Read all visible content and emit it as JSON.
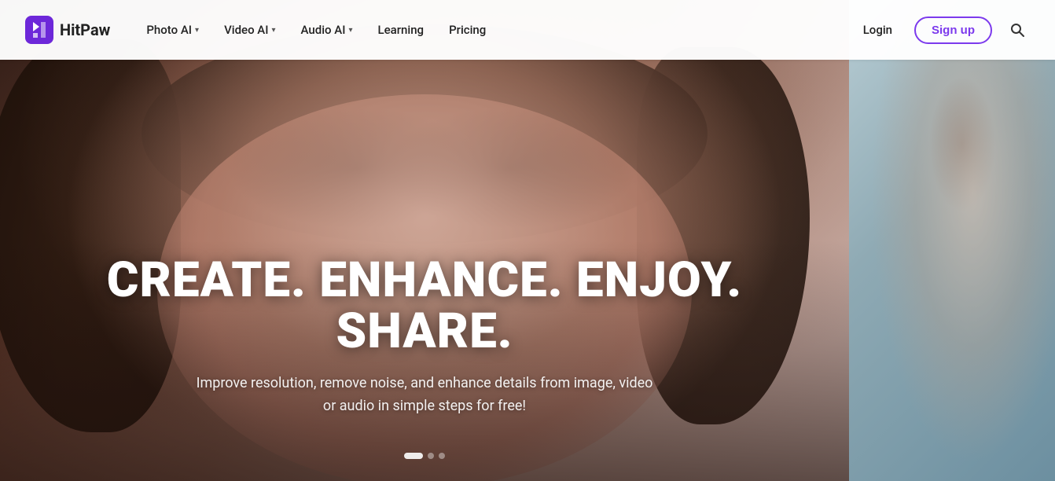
{
  "brand": {
    "name": "HitPaw"
  },
  "navbar": {
    "logo_alt": "HitPaw logo",
    "links": [
      {
        "label": "Photo AI",
        "has_dropdown": true,
        "id": "photo-ai"
      },
      {
        "label": "Video AI",
        "has_dropdown": true,
        "id": "video-ai"
      },
      {
        "label": "Audio AI",
        "has_dropdown": true,
        "id": "audio-ai"
      },
      {
        "label": "Learning",
        "has_dropdown": false,
        "id": "learning"
      },
      {
        "label": "Pricing",
        "has_dropdown": false,
        "id": "pricing"
      }
    ],
    "login_label": "Login",
    "signup_label": "Sign up",
    "search_aria": "Search"
  },
  "hero": {
    "headline": "CREATE. ENHANCE. ENJOY. SHARE.",
    "subtext": "Improve resolution, remove noise, and enhance details from image, video\nor audio in simple steps for free!",
    "pagination": {
      "total": 3,
      "active": 0
    }
  },
  "colors": {
    "accent": "#7c3aed",
    "nav_bg": "#ffffff"
  }
}
